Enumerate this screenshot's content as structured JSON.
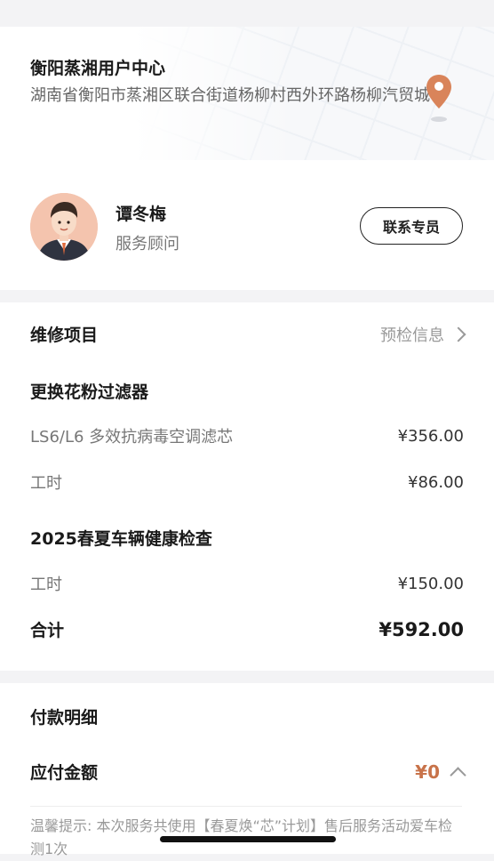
{
  "store": {
    "name": "衡阳蒸湘用户中心",
    "address": "湖南省衡阳市蒸湘区联合街道杨柳村西外环路杨柳汽贸城"
  },
  "advisor": {
    "name": "谭冬梅",
    "role": "服务顾问",
    "contact_label": "联系专员"
  },
  "service": {
    "section_title": "维修项目",
    "precheck_label": "预检信息",
    "groups": [
      {
        "title": "更换花粉过滤器",
        "items": [
          {
            "name": "LS6/L6 多效抗病毒空调滤芯",
            "price": "¥356.00"
          },
          {
            "name": "工时",
            "price": "¥86.00"
          }
        ]
      },
      {
        "title": "2025春夏车辆健康检查",
        "items": [
          {
            "name": "工时",
            "price": "¥150.00"
          }
        ]
      }
    ],
    "total_label": "合计",
    "total_value": "¥592.00"
  },
  "payment": {
    "section_title": "付款明细",
    "payable_label": "应付金额",
    "payable_value": "¥0",
    "tip": "温馨提示: 本次服务共使用【春夏焕“芯”计划】售后服务活动爱车检测1次"
  },
  "colors": {
    "accent": "#c8734a",
    "pin": "#d9845a"
  },
  "icons": {
    "location": "location-pin-icon",
    "chevron_right": "chevron-right-icon",
    "chevron_up": "chevron-up-icon"
  }
}
